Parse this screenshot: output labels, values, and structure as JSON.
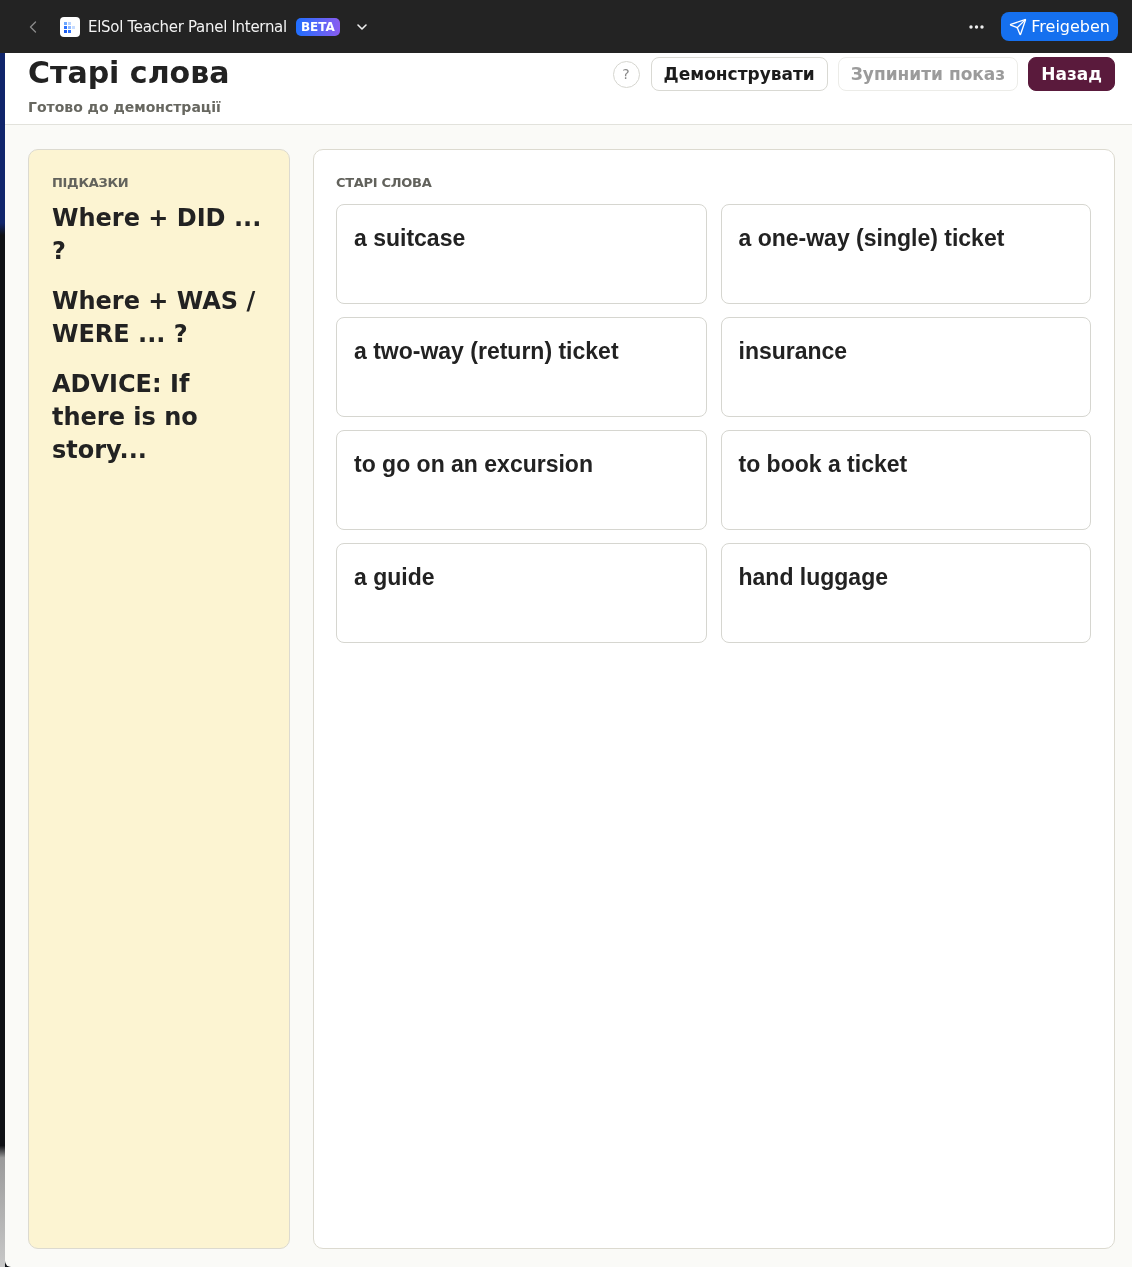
{
  "app_bar": {
    "app_name": "ElSol Teacher Panel Internal",
    "badge": "BETA",
    "share_button": "Freigeben"
  },
  "header": {
    "title": "Старі слова",
    "status": "Готово до демонстрації",
    "help": "?",
    "buttons": [
      {
        "label": "Демонструвати",
        "kind": "outline",
        "disabled": false
      },
      {
        "label": "Зупинити показ",
        "kind": "outline",
        "disabled": true
      },
      {
        "label": "Назад",
        "kind": "primary",
        "disabled": false
      }
    ]
  },
  "hints": {
    "heading": "ПІДКАЗКИ",
    "items": [
      "Where + DID ... ?",
      "Where + WAS / WERE ... ?",
      "ADVICE: If there is no story..."
    ]
  },
  "words": {
    "heading": "СТАРІ СЛОВА",
    "cards": [
      "a suitcase",
      "a one-way (single) ticket",
      "a two-way (return) ticket",
      "insurance",
      "to go on an excursion",
      "to book a ticket",
      "a guide",
      "hand luggage"
    ]
  }
}
